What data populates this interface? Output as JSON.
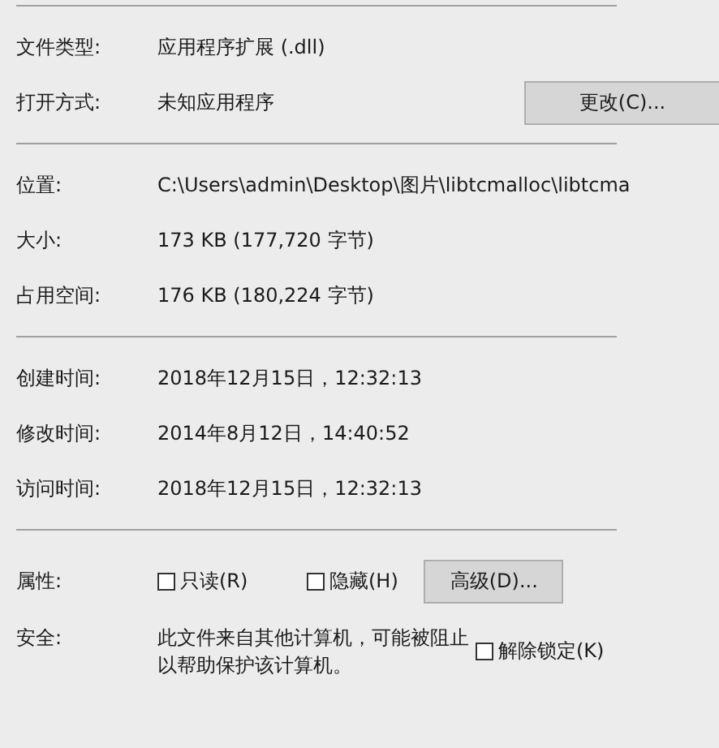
{
  "sections": [
    {
      "rows": [
        {
          "kind": "text",
          "label": "文件类型:",
          "value": "应用程序扩展 (.dll)"
        },
        {
          "kind": "button",
          "label": "打开方式:",
          "value": "未知应用程序",
          "button": "更改(C)..."
        }
      ]
    },
    {
      "rows": [
        {
          "kind": "text",
          "label": "位置:",
          "value": "C:\\Users\\admin\\Desktop\\图片\\libtcmalloc\\libtcma"
        },
        {
          "kind": "text",
          "label": "大小:",
          "value": "173 KB (177,720 字节)"
        },
        {
          "kind": "text",
          "label": "占用空间:",
          "value": "176 KB (180,224 字节)"
        }
      ]
    },
    {
      "rows": [
        {
          "kind": "text",
          "label": "创建时间:",
          "value": "2018年12月15日，12:32:13"
        },
        {
          "kind": "text",
          "label": "修改时间:",
          "value": "2014年8月12日，14:40:52"
        },
        {
          "kind": "text",
          "label": "访问时间:",
          "value": "2018年12月15日，12:32:13"
        }
      ]
    }
  ],
  "attributes": {
    "label": "属性:",
    "checkboxes": [
      {
        "label": "只读(R)",
        "checked": false
      },
      {
        "label": "隐藏(H)",
        "checked": false
      }
    ],
    "button": "高级(D)..."
  },
  "security": {
    "label": "安全:",
    "text": "此文件来自其他计算机，可能被阻止以帮助保护该计算机。",
    "checkbox": {
      "label": "解除锁定(K)",
      "checked": false
    }
  }
}
